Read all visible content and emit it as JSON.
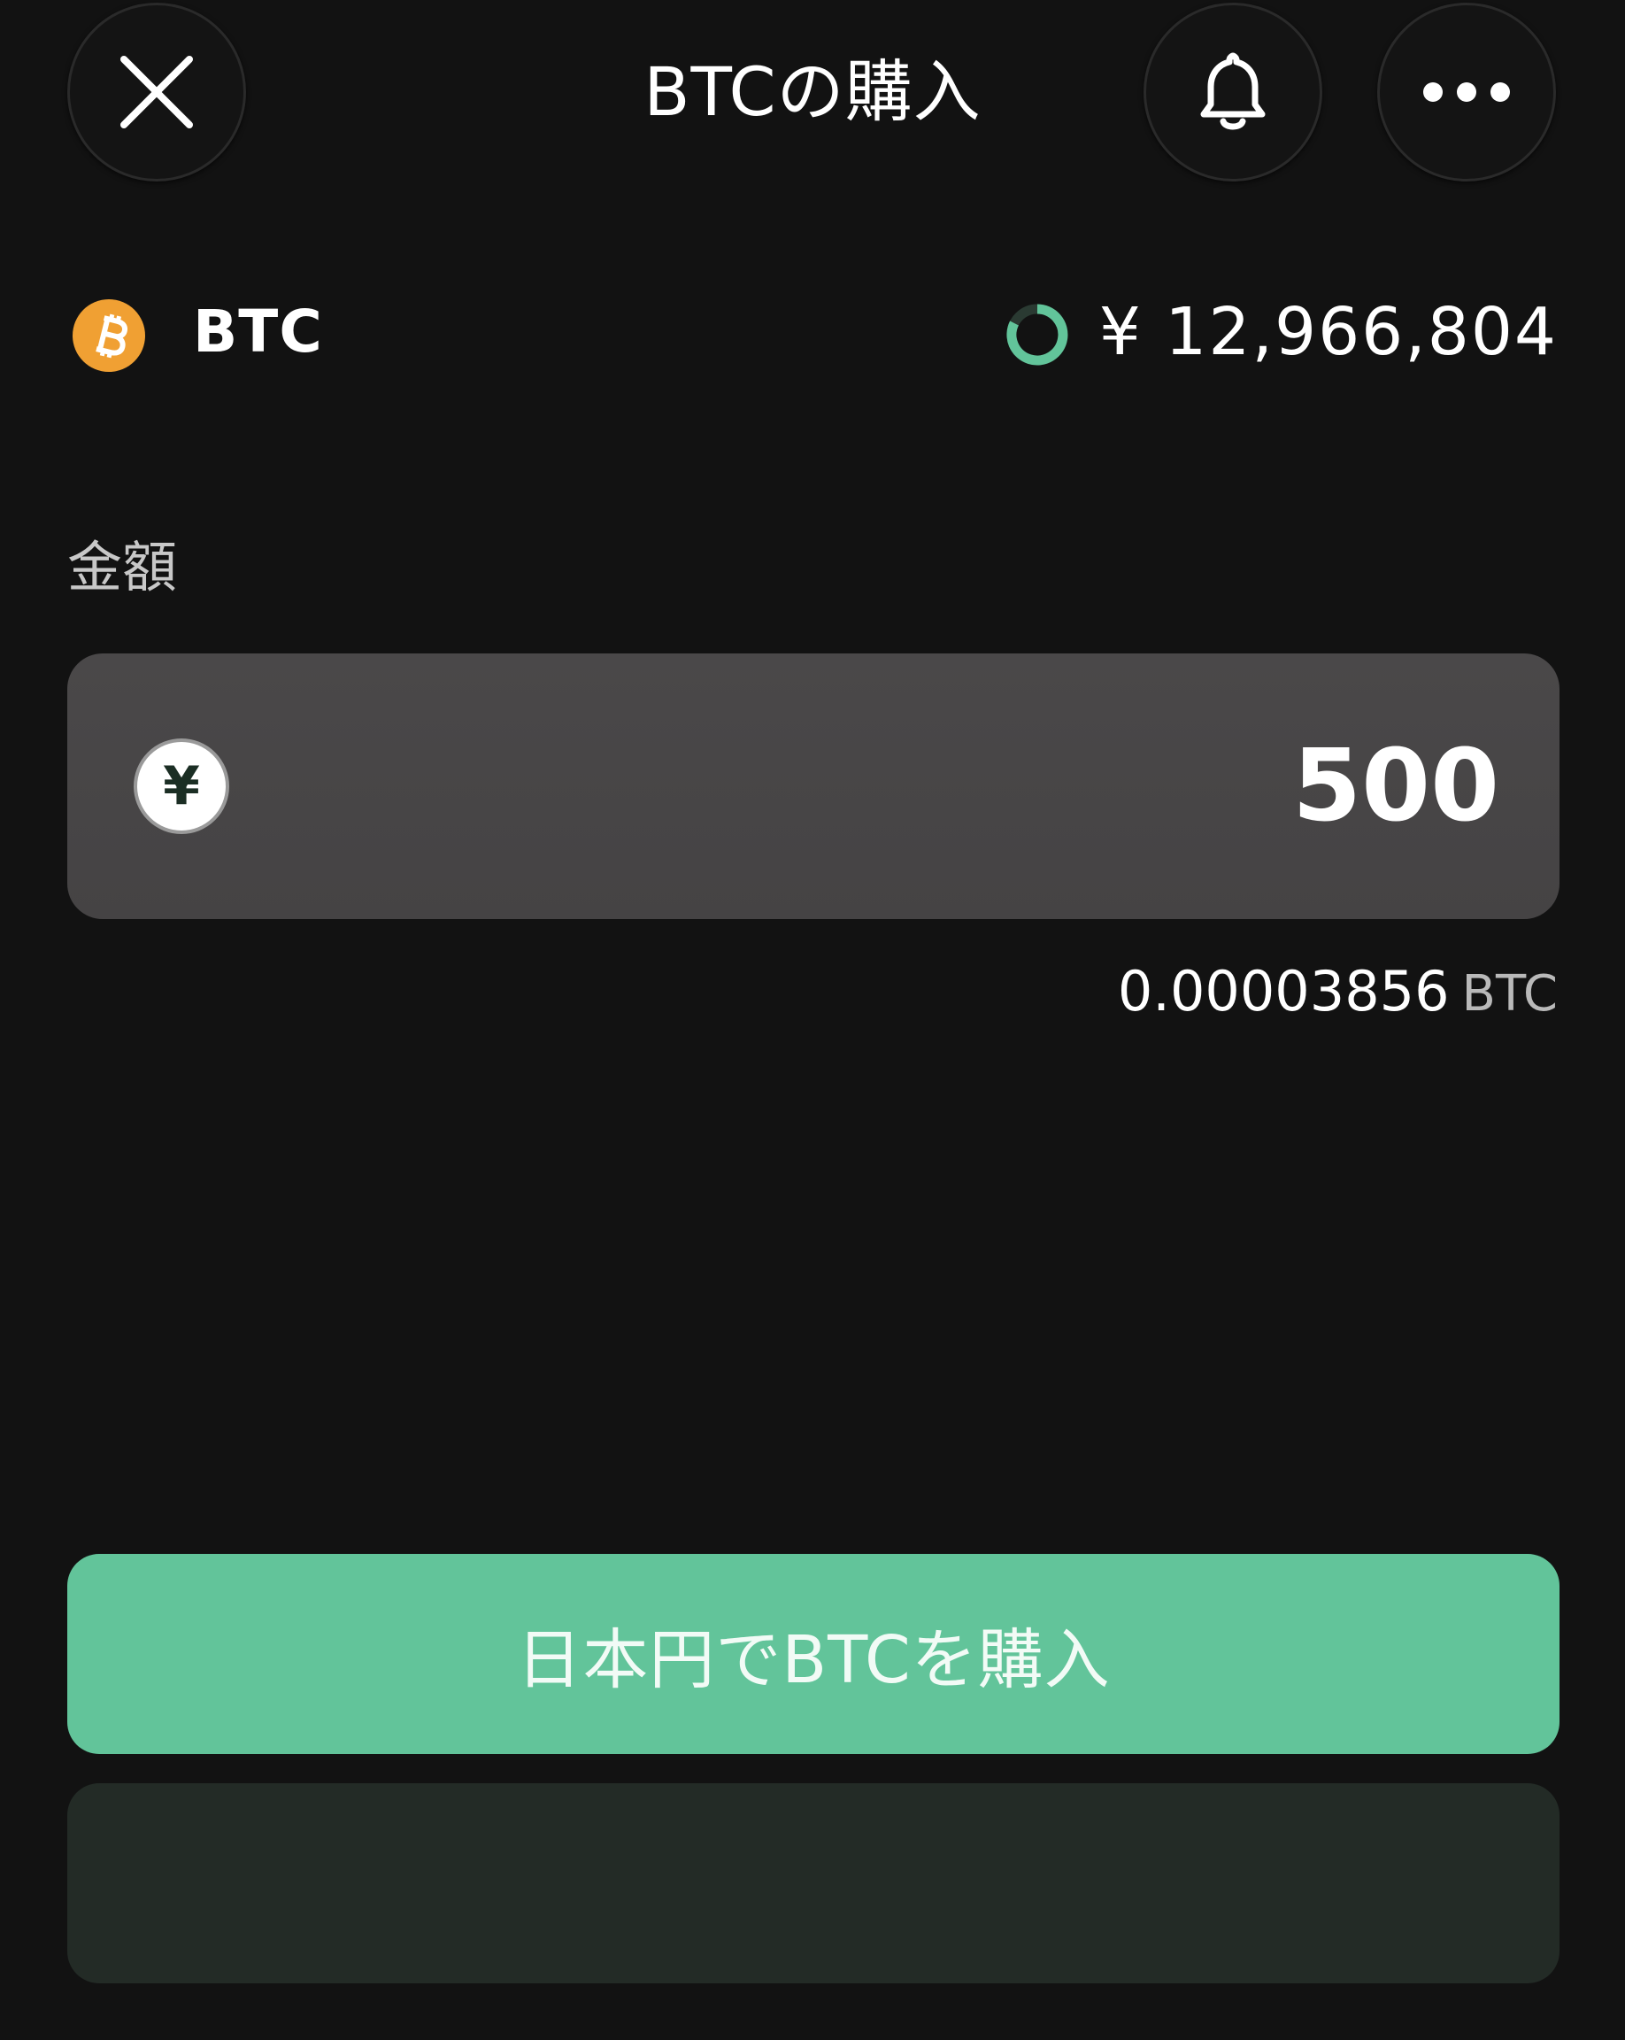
{
  "header": {
    "title": "BTCの購入",
    "close_icon": "close-icon",
    "bell_icon": "bell-icon",
    "more_icon": "more-icon"
  },
  "asset": {
    "icon": "bitcoin-icon",
    "name": "BTC",
    "price": "¥ 12,966,804",
    "refresh_icon": "refresh-progress-icon"
  },
  "amount": {
    "label": "金額",
    "currency_icon": "yen-coin-icon",
    "currency_symbol": "¥",
    "value": "500",
    "converted_value": "0.00003856",
    "converted_unit": "BTC"
  },
  "actions": {
    "buy_label": "日本円でBTCを購入"
  },
  "colors": {
    "background": "#121212",
    "accent_green": "#62c49a",
    "bitcoin_orange": "#f0a033",
    "input_bg": "#474546",
    "secondary_panel": "#232b26"
  }
}
